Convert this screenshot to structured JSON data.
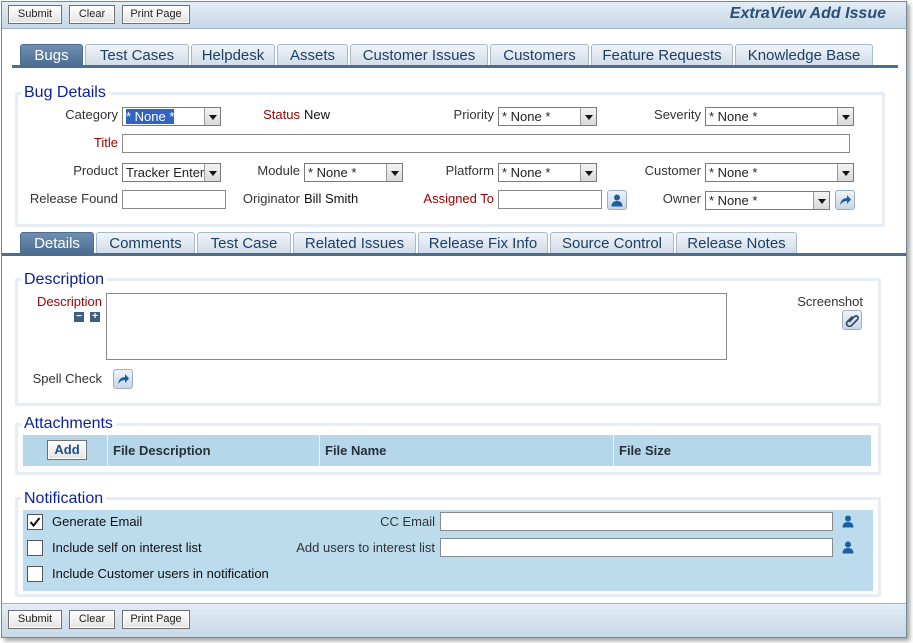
{
  "toolbar": {
    "submit": "Submit",
    "clear": "Clear",
    "print": "Print Page"
  },
  "app_title": "ExtraView Add Issue",
  "main_tabs": [
    "Bugs",
    "Test Cases",
    "Helpdesk",
    "Assets",
    "Customer Issues",
    "Customers",
    "Feature Requests",
    "Knowledge Base"
  ],
  "main_tabs_active": "Bugs",
  "bug_details": {
    "title": "Bug Details",
    "category": {
      "label": "Category",
      "value": "* None *"
    },
    "status": {
      "label": "Status",
      "value": "New"
    },
    "priority": {
      "label": "Priority",
      "value": "* None *"
    },
    "severity": {
      "label": "Severity",
      "value": "* None *"
    },
    "title_field": {
      "label": "Title",
      "value": ""
    },
    "product": {
      "label": "Product",
      "value": "Tracker Enter"
    },
    "module": {
      "label": "Module",
      "value": "* None *"
    },
    "platform": {
      "label": "Platform",
      "value": "* None *"
    },
    "customer": {
      "label": "Customer",
      "value": "* None *"
    },
    "release_found": {
      "label": "Release Found",
      "value": ""
    },
    "originator": {
      "label": "Originator",
      "value": "Bill Smith"
    },
    "assigned_to": {
      "label": "Assigned To",
      "value": ""
    },
    "owner": {
      "label": "Owner",
      "value": "* None *"
    }
  },
  "detail_tabs": [
    "Details",
    "Comments",
    "Test Case",
    "Related Issues",
    "Release Fix Info",
    "Source Control",
    "Release Notes"
  ],
  "detail_tabs_active": "Details",
  "description": {
    "section_title": "Description",
    "label": "Description",
    "value": "",
    "screenshot_label": "Screenshot",
    "spell_check_label": "Spell Check"
  },
  "attachments": {
    "section_title": "Attachments",
    "add_label": "Add",
    "columns": [
      "File Description",
      "File Name",
      "File Size"
    ]
  },
  "notification": {
    "section_title": "Notification",
    "generate_email": {
      "label": "Generate Email",
      "checked": true
    },
    "include_self": {
      "label": "Include self on interest list",
      "checked": false
    },
    "include_customer": {
      "label": "Include Customer users in notification",
      "checked": false
    },
    "cc_email": {
      "label": "CC Email",
      "value": ""
    },
    "add_users": {
      "label": "Add users to interest list",
      "value": ""
    }
  },
  "colors": {
    "accent": "#4b6d92",
    "section_title": "#0a1f9c",
    "required": "#a00000",
    "grid": "#b6d6ea"
  },
  "icons": [
    "user-lookup-icon",
    "arrow-action-icon",
    "paperclip-icon",
    "checkmark-icon",
    "collapse-icon",
    "expand-icon"
  ]
}
